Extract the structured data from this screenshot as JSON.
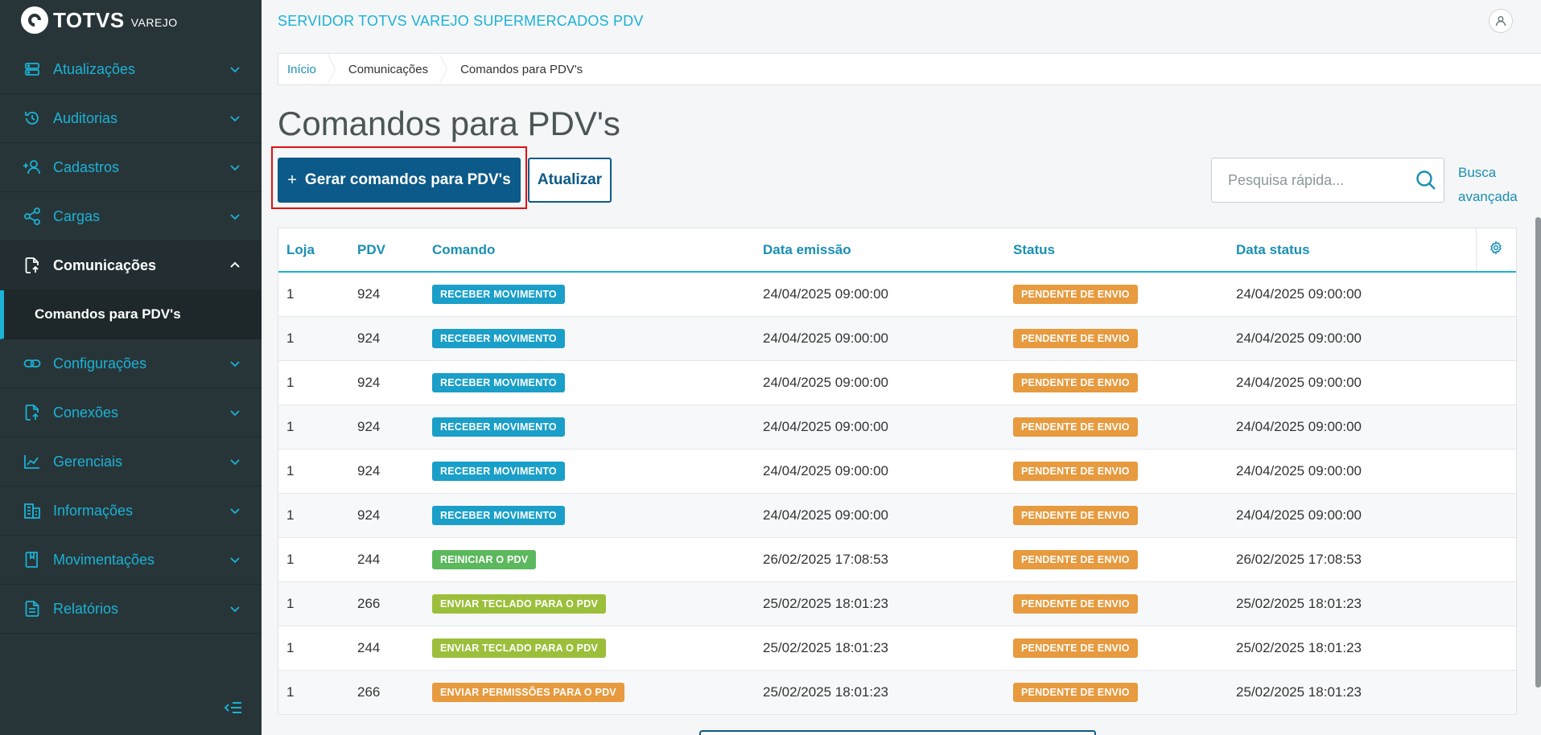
{
  "brand": {
    "name": "TOTVS",
    "sub": "VAREJO"
  },
  "header": {
    "server_title": "SERVIDOR TOTVS VAREJO SUPERMERCADOS PDV"
  },
  "sidebar": {
    "items": [
      {
        "label": "Atualizações",
        "icon": "server-icon"
      },
      {
        "label": "Auditorias",
        "icon": "history-icon"
      },
      {
        "label": "Cadastros",
        "icon": "add-user-icon"
      },
      {
        "label": "Cargas",
        "icon": "share-icon"
      },
      {
        "label": "Comunicações",
        "icon": "file-upload-icon",
        "active": true
      },
      {
        "label": "Configurações",
        "icon": "link-icon"
      },
      {
        "label": "Conexões",
        "icon": "file-upload-icon"
      },
      {
        "label": "Gerenciais",
        "icon": "chart-icon"
      },
      {
        "label": "Informações",
        "icon": "building-icon"
      },
      {
        "label": "Movimentações",
        "icon": "book-icon"
      },
      {
        "label": "Relatórios",
        "icon": "document-icon"
      }
    ],
    "subitem": "Comandos para PDV's"
  },
  "breadcrumb": {
    "home": "Início",
    "section": "Comunicações",
    "current": "Comandos para PDV's"
  },
  "page": {
    "title": "Comandos para PDV's",
    "primary_button": "Gerar comandos para PDV's",
    "secondary_button": "Atualizar",
    "search_placeholder": "Pesquisa rápida...",
    "advanced_search_line1": "Busca",
    "advanced_search_line2": "avançada"
  },
  "table": {
    "columns": [
      "Loja",
      "PDV",
      "Comando",
      "Data emissão",
      "Status",
      "Data status"
    ],
    "rows": [
      {
        "loja": "1",
        "pdv": "924",
        "comando": "RECEBER MOVIMENTO",
        "comando_color": "#1a9fc9",
        "emissao": "24/04/2025 09:00:00",
        "status": "PENDENTE DE ENVIO",
        "data_status": "24/04/2025 09:00:00"
      },
      {
        "loja": "1",
        "pdv": "924",
        "comando": "RECEBER MOVIMENTO",
        "comando_color": "#1a9fc9",
        "emissao": "24/04/2025 09:00:00",
        "status": "PENDENTE DE ENVIO",
        "data_status": "24/04/2025 09:00:00"
      },
      {
        "loja": "1",
        "pdv": "924",
        "comando": "RECEBER MOVIMENTO",
        "comando_color": "#1a9fc9",
        "emissao": "24/04/2025 09:00:00",
        "status": "PENDENTE DE ENVIO",
        "data_status": "24/04/2025 09:00:00"
      },
      {
        "loja": "1",
        "pdv": "924",
        "comando": "RECEBER MOVIMENTO",
        "comando_color": "#1a9fc9",
        "emissao": "24/04/2025 09:00:00",
        "status": "PENDENTE DE ENVIO",
        "data_status": "24/04/2025 09:00:00"
      },
      {
        "loja": "1",
        "pdv": "924",
        "comando": "RECEBER MOVIMENTO",
        "comando_color": "#1a9fc9",
        "emissao": "24/04/2025 09:00:00",
        "status": "PENDENTE DE ENVIO",
        "data_status": "24/04/2025 09:00:00"
      },
      {
        "loja": "1",
        "pdv": "924",
        "comando": "RECEBER MOVIMENTO",
        "comando_color": "#1a9fc9",
        "emissao": "24/04/2025 09:00:00",
        "status": "PENDENTE DE ENVIO",
        "data_status": "24/04/2025 09:00:00"
      },
      {
        "loja": "1",
        "pdv": "244",
        "comando": "REINICIAR O PDV",
        "comando_color": "#5cb85c",
        "emissao": "26/02/2025 17:08:53",
        "status": "PENDENTE DE ENVIO",
        "data_status": "26/02/2025 17:08:53"
      },
      {
        "loja": "1",
        "pdv": "266",
        "comando": "ENVIAR TECLADO PARA O PDV",
        "comando_color": "#9cbf3b",
        "emissao": "25/02/2025 18:01:23",
        "status": "PENDENTE DE ENVIO",
        "data_status": "25/02/2025 18:01:23"
      },
      {
        "loja": "1",
        "pdv": "244",
        "comando": "ENVIAR TECLADO PARA O PDV",
        "comando_color": "#9cbf3b",
        "emissao": "25/02/2025 18:01:23",
        "status": "PENDENTE DE ENVIO",
        "data_status": "25/02/2025 18:01:23"
      },
      {
        "loja": "1",
        "pdv": "266",
        "comando": "ENVIAR PERMISSÕES PARA O PDV",
        "comando_color": "#e79a3e",
        "emissao": "25/02/2025 18:01:23",
        "status": "PENDENTE DE ENVIO",
        "data_status": "25/02/2025 18:01:23"
      }
    ],
    "status_color": "#e79a3e"
  },
  "colors": {
    "accent": "#1bb2d6",
    "primary": "#0c5a89",
    "sidebar_bg": "#283538",
    "highlight": "#e0120f"
  }
}
